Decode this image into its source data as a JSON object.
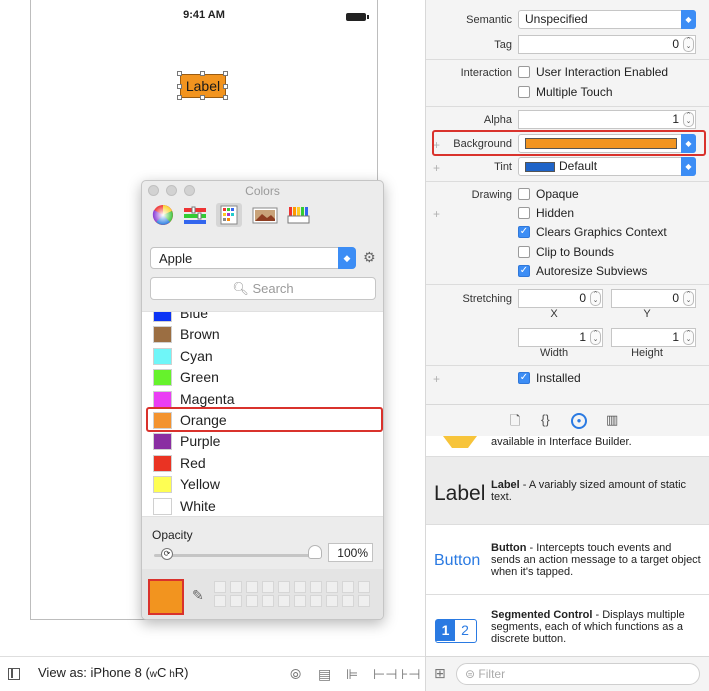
{
  "canvas": {
    "status_time": "9:41 AM",
    "label_text": "Label"
  },
  "colors_panel": {
    "title": "Colors",
    "palette": "Apple",
    "search_placeholder": "Search",
    "colors": [
      {
        "name": "Blue",
        "hex": "#0b33f5"
      },
      {
        "name": "Brown",
        "hex": "#9b6e42"
      },
      {
        "name": "Cyan",
        "hex": "#6ff6f8"
      },
      {
        "name": "Green",
        "hex": "#66f22c"
      },
      {
        "name": "Magenta",
        "hex": "#ea3df4"
      },
      {
        "name": "Orange",
        "hex": "#f3932f"
      },
      {
        "name": "Purple",
        "hex": "#8a2ea2"
      },
      {
        "name": "Red",
        "hex": "#ea3323"
      },
      {
        "name": "Yellow",
        "hex": "#fefe53"
      },
      {
        "name": "White",
        "hex": "#ffffff"
      }
    ],
    "selected_color": "Orange",
    "opacity_label": "Opacity",
    "opacity_value": "100%",
    "current_swatch_hex": "#f2941f"
  },
  "bottom_bar": {
    "view_as_prefix": "View as: iPhone 8 (",
    "w_small": "w",
    "c_big": "C",
    "h_small": "h",
    "r_big": "R",
    "close_paren": ")"
  },
  "inspector": {
    "semantic_label": "Semantic",
    "semantic_value": "Unspecified",
    "tag_label": "Tag",
    "tag_value": "0",
    "interaction_label": "Interaction",
    "user_interaction": "User Interaction Enabled",
    "multiple_touch": "Multiple Touch",
    "alpha_label": "Alpha",
    "alpha_value": "1",
    "background_label": "Background",
    "background_hex": "#f2941f",
    "tint_label": "Tint",
    "tint_value": "Default",
    "tint_hex": "#1f64c8",
    "drawing_label": "Drawing",
    "opaque": "Opaque",
    "hidden": "Hidden",
    "clears_graphics": "Clears Graphics Context",
    "clip_bounds": "Clip to Bounds",
    "autoresize": "Autoresize Subviews",
    "stretching_label": "Stretching",
    "stretch_x": "0",
    "stretch_y": "0",
    "stretch_w": "1",
    "stretch_h": "1",
    "x_label": "X",
    "y_label": "Y",
    "width_label": "Width",
    "height_label": "Height",
    "installed": "Installed"
  },
  "library": {
    "partial_text": "available in Interface Builder.",
    "items": [
      {
        "glyph": "Label",
        "title": "Label",
        "desc": " - A variably sized amount of static text."
      },
      {
        "glyph": "Button",
        "title": "Button",
        "desc": " - Intercepts touch events and sends an action message to a target object when it's tapped."
      },
      {
        "glyph": "",
        "title": "Segmented Control",
        "desc": " - Displays multiple segments, each of which functions as a discrete button."
      }
    ],
    "segment_1": "1",
    "segment_2": "2",
    "filter_placeholder": "Filter"
  }
}
